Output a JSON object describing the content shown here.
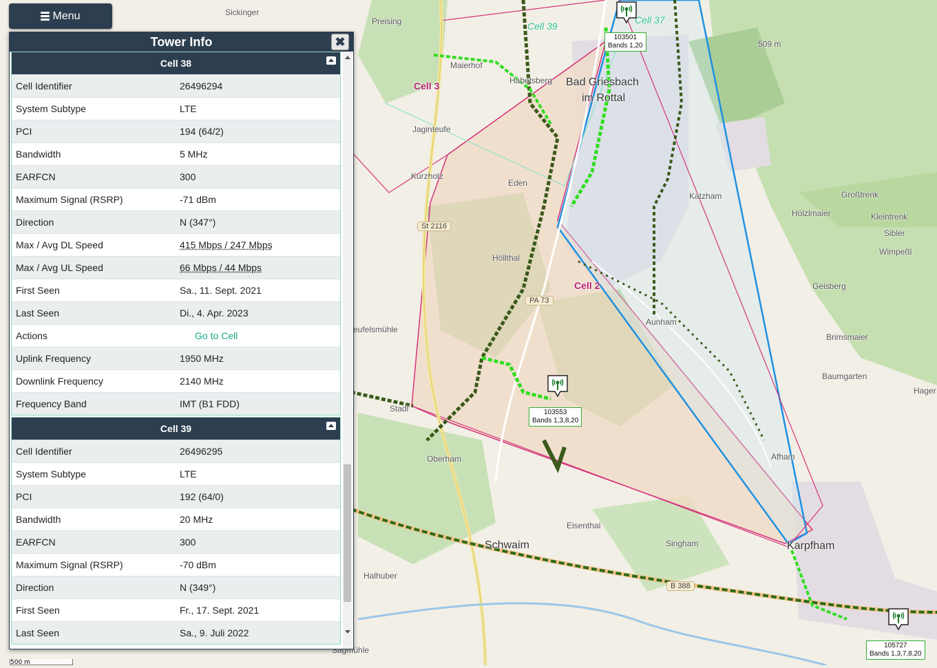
{
  "menu": {
    "label": "Menu"
  },
  "panel": {
    "title": "Tower Info",
    "close_label": "✖",
    "cells": [
      {
        "title": "Cell 38",
        "rows": [
          {
            "key": "Cell Identifier",
            "value": "26496294"
          },
          {
            "key": "System Subtype",
            "value": "LTE"
          },
          {
            "key": "PCI",
            "value": "194 (64/2)"
          },
          {
            "key": "Bandwidth",
            "value": "5 MHz"
          },
          {
            "key": "EARFCN",
            "value": "300"
          },
          {
            "key": "Maximum Signal (RSRP)",
            "value": "-71 dBm"
          },
          {
            "key": "Direction",
            "value": "N (347°)"
          },
          {
            "key": "Max / Avg DL Speed",
            "value": "415 Mbps / 247 Mbps"
          },
          {
            "key": "Max / Avg UL Speed",
            "value": "66 Mbps / 44 Mbps"
          },
          {
            "key": "First Seen",
            "value": "Sa., 11. Sept. 2021"
          },
          {
            "key": "Last Seen",
            "value": "Di., 4. Apr. 2023"
          },
          {
            "key": "Actions",
            "value": "Go to Cell"
          },
          {
            "key": "Uplink Frequency",
            "value": "1950 MHz"
          },
          {
            "key": "Downlink Frequency",
            "value": "2140 MHz"
          },
          {
            "key": "Frequency Band",
            "value": "IMT (B1 FDD)"
          }
        ]
      },
      {
        "title": "Cell 39",
        "rows": [
          {
            "key": "Cell Identifier",
            "value": "26496295"
          },
          {
            "key": "System Subtype",
            "value": "LTE"
          },
          {
            "key": "PCI",
            "value": "192 (64/0)"
          },
          {
            "key": "Bandwidth",
            "value": "20 MHz"
          },
          {
            "key": "EARFCN",
            "value": "300"
          },
          {
            "key": "Maximum Signal (RSRP)",
            "value": "-70 dBm"
          },
          {
            "key": "Direction",
            "value": "N (349°)"
          },
          {
            "key": "First Seen",
            "value": "Fr., 17. Sept. 2021"
          },
          {
            "key": "Last Seen",
            "value": "Sa., 9. Juli 2022"
          }
        ]
      }
    ]
  },
  "map": {
    "colors": {
      "coverage_fill": "#f0d9c6",
      "cell_outline": "#d6337a",
      "selected_outline": "#1e90e0",
      "strong_signal": "#33dd22",
      "weak_signal": "#3a5a1a"
    },
    "labels": [
      {
        "text": "Sickinger"
      },
      {
        "text": "Preising"
      },
      {
        "text": "Maierhof"
      },
      {
        "text": "Habetsberg"
      },
      {
        "text": "Bad Griesbach"
      },
      {
        "text": "im Rottal"
      },
      {
        "text": "Jaginteufe"
      },
      {
        "text": "Kurzholz"
      },
      {
        "text": "Eden"
      },
      {
        "text": "Katzham"
      },
      {
        "text": "Großtrenk"
      },
      {
        "text": "Hölzlmaier"
      },
      {
        "text": "Kleintrenk"
      },
      {
        "text": "Sibler"
      },
      {
        "text": "Wimpeßl"
      },
      {
        "text": "Höllthal"
      },
      {
        "text": "Geisberg"
      },
      {
        "text": "Aunham"
      },
      {
        "text": "Brimsmaier"
      },
      {
        "text": "Baumgarten"
      },
      {
        "text": "Hager"
      },
      {
        "text": "Stadl"
      },
      {
        "text": "Oberham"
      },
      {
        "text": "Afham"
      },
      {
        "text": "Eisenthal"
      },
      {
        "text": "Schwaim"
      },
      {
        "text": "Singham"
      },
      {
        "text": "Karpfham"
      },
      {
        "text": "Halhuber"
      },
      {
        "text": "Sagmühle"
      },
      {
        "text": "509 m"
      },
      {
        "text": "eufelsmühle"
      }
    ],
    "cell_labels": [
      "Cell 3",
      "Cell 2",
      "Cell 39",
      "Cell 37"
    ],
    "roads": [
      "St 2116",
      "PA 73",
      "B 388"
    ],
    "towers": [
      {
        "id": "103501",
        "bands": "Bands 1,20"
      },
      {
        "id": "103553",
        "bands": "Bands 1,3,8,20"
      },
      {
        "id": "105727",
        "bands": "Bands 1,3,7,8,20"
      }
    ],
    "scale": "500 m"
  }
}
